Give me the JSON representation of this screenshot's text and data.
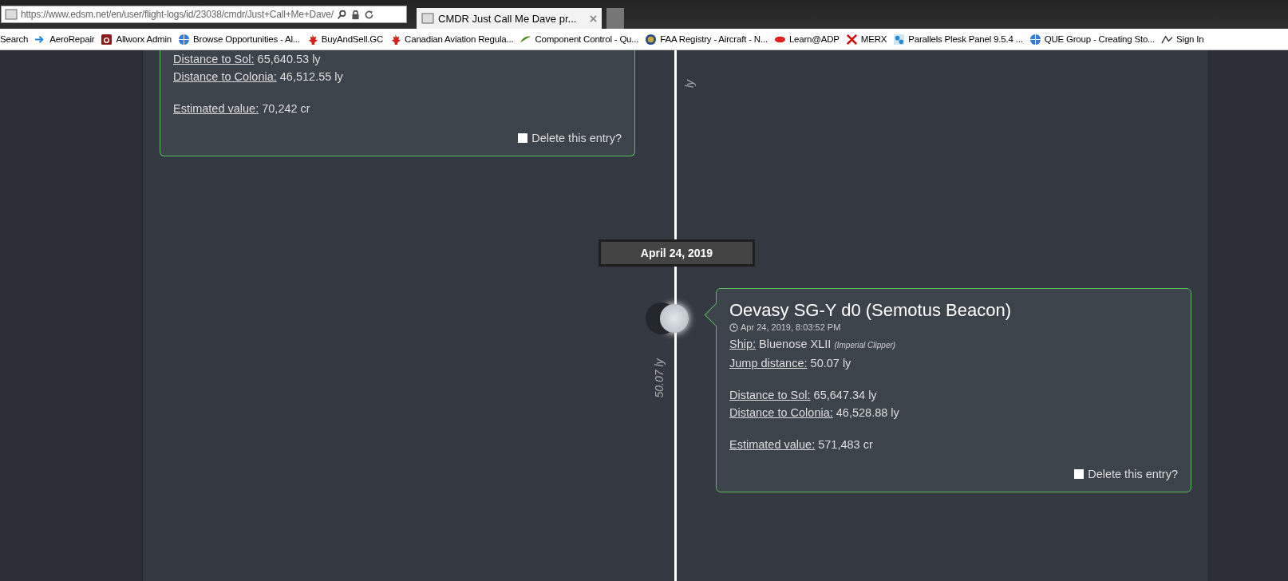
{
  "browser": {
    "address_bar": {
      "url": "https://www.edsm.net/en/user/flight-logs/id/23038/cmdr/Just+Call+Me+Dave/"
    },
    "tab": {
      "title": "CMDR Just Call Me Dave pr..."
    },
    "bookmarks": [
      {
        "label": "Search",
        "kind": "none"
      },
      {
        "label": "AeroRepair",
        "kind": "arrow"
      },
      {
        "label": "Allworx Admin",
        "kind": "tile"
      },
      {
        "label": "Browse Opportunities - Al...",
        "kind": "globe"
      },
      {
        "label": "BuyAndSell.GC",
        "kind": "leaf"
      },
      {
        "label": "Canadian Aviation Regula...",
        "kind": "leaf"
      },
      {
        "label": "Component Control - Qu...",
        "kind": "swoosh"
      },
      {
        "label": "FAA Registry - Aircraft - N...",
        "kind": "seal"
      },
      {
        "label": "Learn@ADP",
        "kind": "logo"
      },
      {
        "label": "MERX",
        "kind": "cross"
      },
      {
        "label": "Parallels Plesk Panel 9.5.4 ...",
        "kind": "gears"
      },
      {
        "label": "QUE Group - Creating Sto...",
        "kind": "globe"
      },
      {
        "label": "Sign In",
        "kind": "caret"
      }
    ]
  },
  "timeline": {
    "entries": [
      {
        "kind": "left",
        "jump_label": "ly",
        "groups": [
          [
            {
              "label": "Distance to Sol:",
              "value": "65,640.53 ly"
            },
            {
              "label": "Distance to Colonia:",
              "value": "46,512.55 ly"
            }
          ],
          [
            {
              "label": "Estimated value:",
              "value": "70,242 cr"
            }
          ]
        ],
        "delete": {
          "label": "Delete this entry?",
          "checked": false
        }
      },
      {
        "kind": "date",
        "date": "April 24, 2019"
      },
      {
        "kind": "right",
        "title": "Oevasy SG-Y d0 (Semotus Beacon)",
        "time": "Apr 24, 2019, 8:03:52 PM",
        "jump_label": "50.07 ly",
        "groups": [
          [
            {
              "label": "Ship:",
              "value": "Bluenose XLII",
              "note": "(Imperial Clipper)"
            },
            {
              "label": "Jump distance:",
              "value": "50.07 ly"
            }
          ],
          [
            {
              "label": "Distance to Sol:",
              "value": "65,647.34 ly"
            },
            {
              "label": "Distance to Colonia:",
              "value": "46,528.88 ly"
            }
          ],
          [
            {
              "label": "Estimated value:",
              "value": "571,483 cr"
            }
          ]
        ],
        "delete": {
          "label": "Delete this entry?",
          "checked": false
        }
      }
    ]
  }
}
